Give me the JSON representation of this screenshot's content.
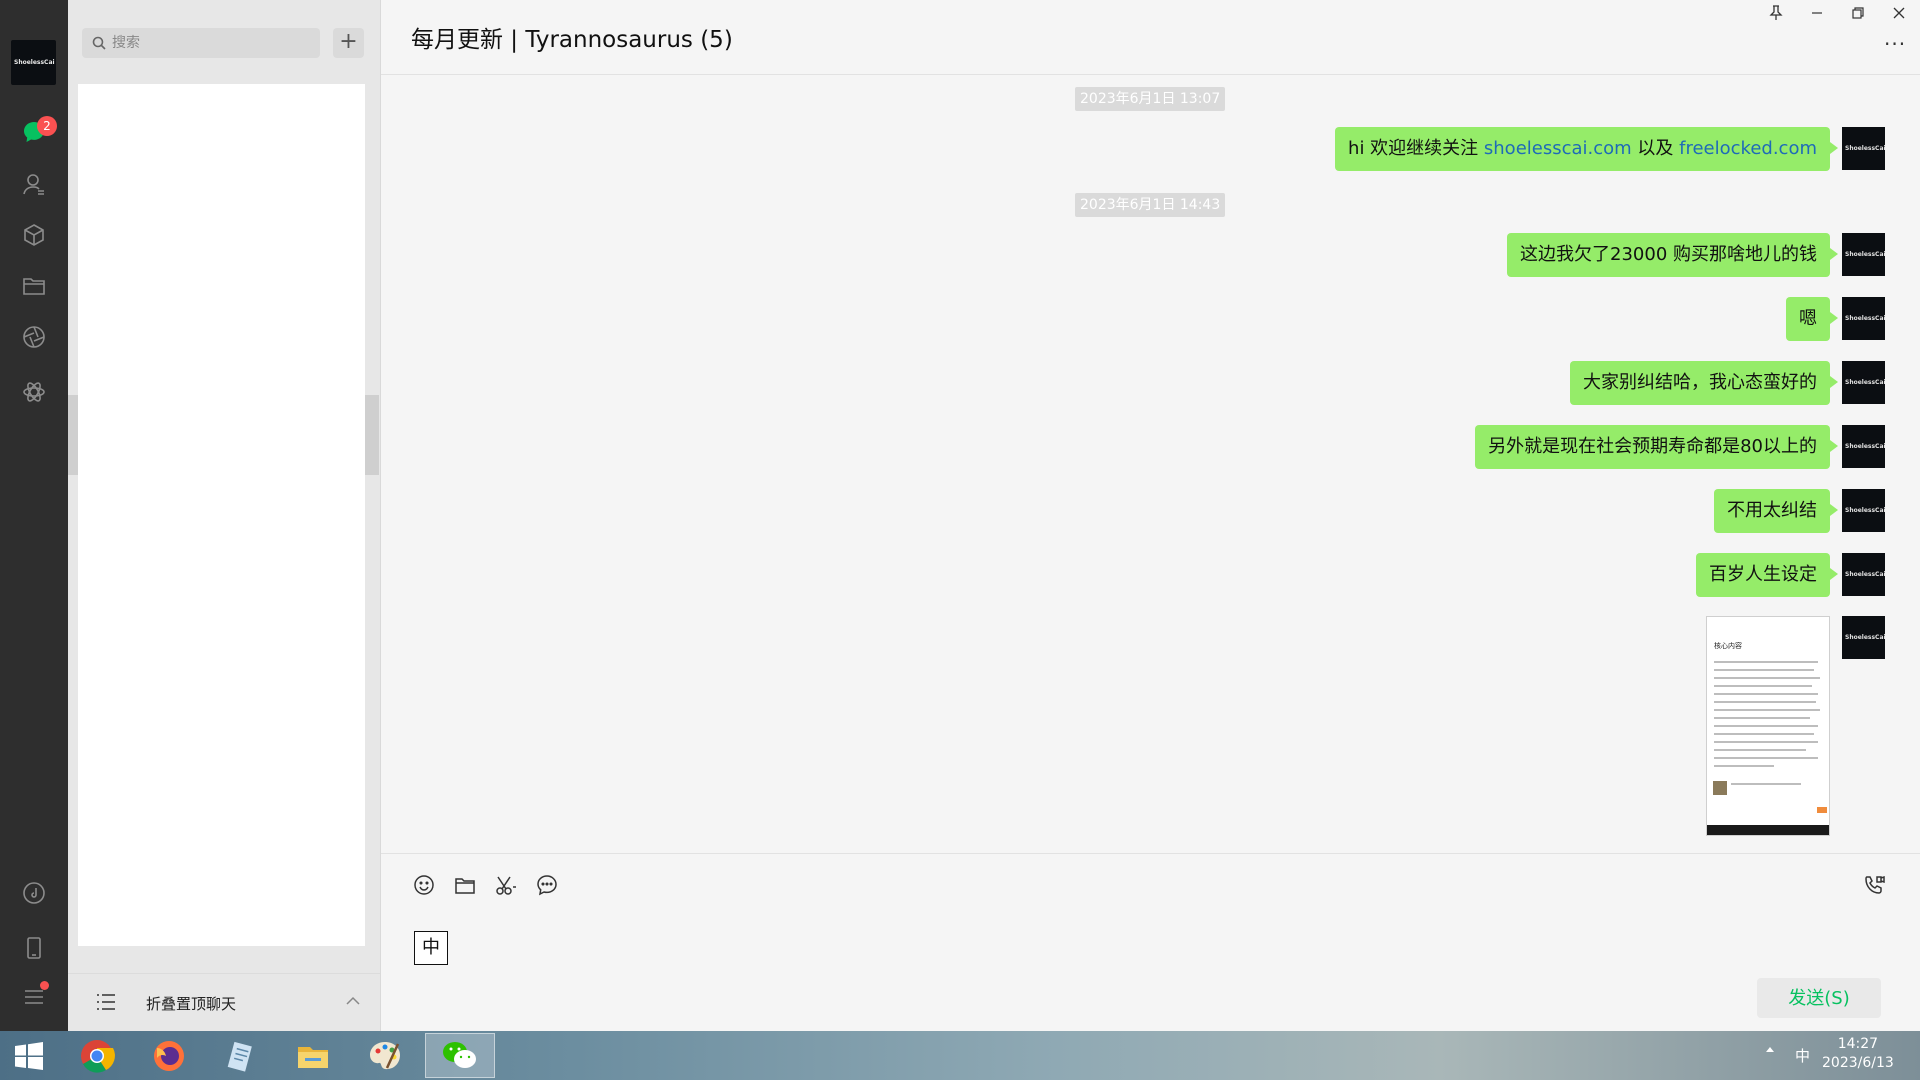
{
  "app": {
    "avatar_text": "ShoelessCai",
    "unread_badge": "2"
  },
  "search": {
    "placeholder": "搜索",
    "add_label": "+"
  },
  "chat_list": {
    "fold_label": "折叠置顶聊天"
  },
  "chat": {
    "title": "每月更新 | Tyrannosaurus (5)",
    "more_label": "···",
    "timestamps": [
      "2023年6月1日 13:07",
      "2023年6月1日 14:43"
    ],
    "messages": [
      {
        "prefix": "hi 欢迎继续关注 ",
        "link1": "shoelesscai.com",
        "middle": " 以及 ",
        "link2": "freelocked.com"
      },
      {
        "text": "这边我欠了23000 购买那啥地儿的钱"
      },
      {
        "text": "嗯"
      },
      {
        "text": "大家别纠结哈，我心态蛮好的"
      },
      {
        "text": "另外就是现在社会预期寿命都是80以上的"
      },
      {
        "text": "不用太纠结"
      },
      {
        "text": "百岁人生设定"
      },
      {
        "image": "screenshot-of-article",
        "image_heading": "核心内容"
      }
    ],
    "ime_indicator": "中",
    "send_label": "发送(S)"
  },
  "taskbar": {
    "time": "14:27",
    "date": "2023/6/13",
    "tray_ime": "中"
  },
  "colors": {
    "bubble": "#95ec69",
    "link": "#1e6bb8",
    "send_text": "#07c160",
    "rail": "#2e2e2e",
    "badge": "#fa5151"
  }
}
